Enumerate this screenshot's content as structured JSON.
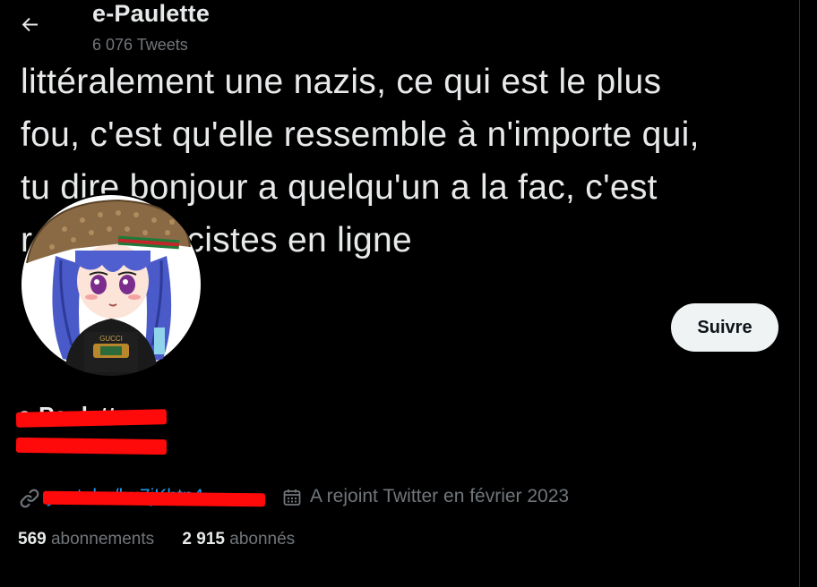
{
  "header": {
    "title": "e-Paulette",
    "tweet_count": "6 076 Tweets",
    "back_icon": "arrow-left-icon"
  },
  "banner": {
    "text": "littéralement une nazis, ce qui est le plus\nfou, c'est qu'elle ressemble à n'importe qui,\ntu dire bonjour a quelqu'un a la fac, c'est\nr                e des fascistes en ligne"
  },
  "profile": {
    "display_name": "e-Paulette",
    "follow_label": "Suivre",
    "link_icon": "link-icon",
    "link_text": "youtube/bu7jKbtn4...",
    "calendar_icon": "calendar-icon",
    "joined": "A rejoint Twitter en février 2023"
  },
  "stats": [
    {
      "value": "569",
      "label": "abonnements"
    },
    {
      "value": "2 915",
      "label": "abonnés"
    }
  ],
  "colors": {
    "background": "#000000",
    "text_primary": "#e7e9ea",
    "text_secondary": "#71767b",
    "link": "#1d9bf0",
    "follow_button_bg": "#eff3f4",
    "redaction": "#ff0a0a"
  }
}
